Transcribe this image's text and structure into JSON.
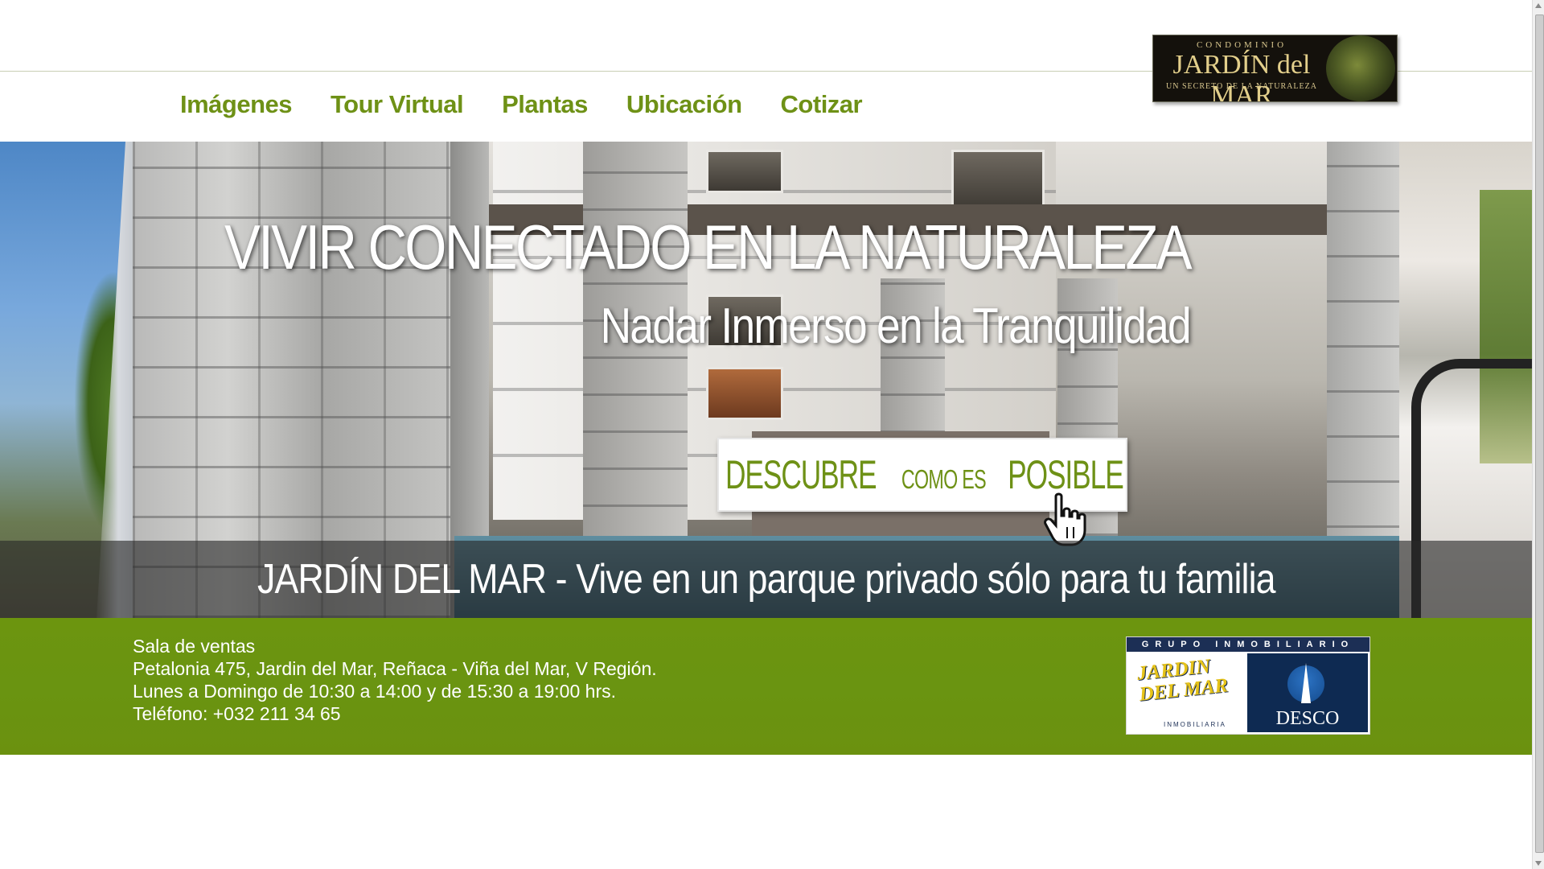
{
  "logo": {
    "condominio": "CONDOMINIO",
    "name": "JARDÍN del MAR",
    "tagline": "UN SECRETO DE LA NATURALEZA"
  },
  "nav": {
    "items": [
      {
        "label": "Imágenes"
      },
      {
        "label": "Tour Virtual"
      },
      {
        "label": "Plantas"
      },
      {
        "label": "Ubicación"
      },
      {
        "label": "Cotizar"
      }
    ]
  },
  "hero": {
    "headline": "VIVIR CONECTADO EN LA NATURALEZA",
    "subline": "Nadar Inmerso en la Tranquilidad",
    "cta": {
      "part1": "DESCUBRE",
      "part2": "COMO ES",
      "part3": "POSIBLE"
    },
    "caption": "JARDÍN DEL MAR - Vive en un parque privado sólo para tu familia"
  },
  "footer": {
    "line1": "Sala de ventas",
    "line2": "Petalonia 475, Jardin del Mar, Reñaca - Viña del Mar, V Región.",
    "line3": "Lunes a Domingo de 10:30 a 14:00 y de 15:30 a 19:00 hrs.",
    "line4": "Teléfono: +032 211 34 65"
  },
  "group_logo": {
    "header": "GRUPO INMOBILIARIO",
    "jardin": "JARDIN DEL MAR",
    "inmobiliaria": "INMOBILIARIA",
    "desco": "DESCO"
  },
  "colors": {
    "accent_green": "#6e9116",
    "footer_green": "#6c950f",
    "logo_bg": "#14110c",
    "caption_overlay": "rgba(40,40,40,.62)"
  },
  "icons": {
    "cta_cursor": "hand-pointer-icon"
  }
}
